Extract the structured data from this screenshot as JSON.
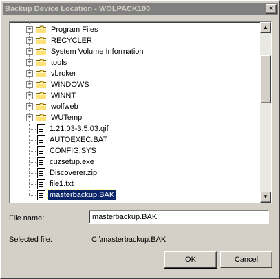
{
  "window": {
    "title": "Backup Device Location - WOLPACK100",
    "close_glyph": "×"
  },
  "tree": {
    "folders": [
      {
        "label": "Program Files"
      },
      {
        "label": "RECYCLER"
      },
      {
        "label": "System Volume Information"
      },
      {
        "label": "tools"
      },
      {
        "label": "vbroker"
      },
      {
        "label": "WINDOWS"
      },
      {
        "label": "WINNT"
      },
      {
        "label": "wolfweb"
      },
      {
        "label": "WUTemp"
      }
    ],
    "files": [
      {
        "label": "1.21.03-3.5.03.qif"
      },
      {
        "label": "AUTOEXEC.BAT"
      },
      {
        "label": "CONFIG.SYS"
      },
      {
        "label": "cuzsetup.exe"
      },
      {
        "label": "Discoverer.zip"
      },
      {
        "label": "file1.txt"
      },
      {
        "label": "masterbackup.BAK"
      }
    ],
    "selected_file": "masterbackup.BAK",
    "expander_glyph": "+",
    "scroll_up_glyph": "▲",
    "scroll_down_glyph": "▼"
  },
  "form": {
    "file_name_label": "File name:",
    "file_name_value": "masterbackup.BAK",
    "selected_file_label": "Selected file:",
    "selected_file_value": "C:\\masterbackup.BAK"
  },
  "buttons": {
    "ok": "OK",
    "cancel": "Cancel"
  },
  "colors": {
    "title_bar": "#808080",
    "selection": "#0a246a",
    "folder": "#ffe17a",
    "face": "#d4d0c8"
  }
}
